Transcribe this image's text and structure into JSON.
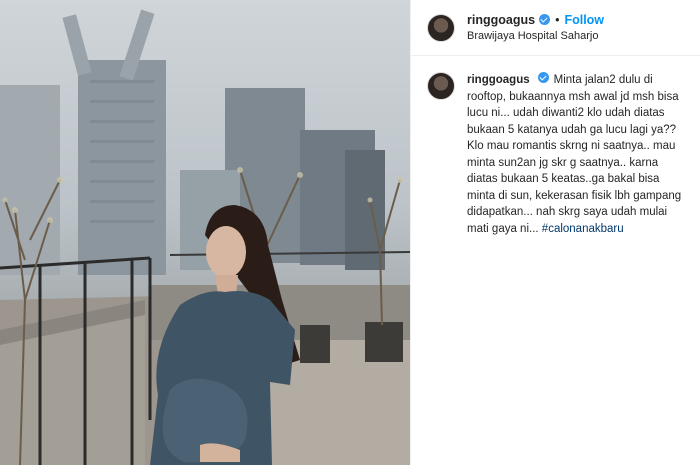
{
  "post": {
    "username": "ringgoagus",
    "follow_label": "Follow",
    "separator": "•",
    "location": "Brawijaya Hospital Saharjo"
  },
  "caption": {
    "username": "ringgoagus",
    "text": "Minta jalan2 dulu di rooftop, bukaannya msh awal jd msh bisa lucu ni... udah diwanti2 klo udah diatas bukaan 5 katanya udah ga lucu lagi ya?? Klo mau romantis skrng ni saatnya.. mau minta sun2an jg skr g saatnya.. karna diatas bukaan 5 keatas..ga bakal bisa minta di sun, kekerasan fisik lbh gampang didapatkan... nah skrg saya udah mulai mati gaya ni...",
    "hashtag": "#calonanakbaru"
  },
  "colors": {
    "link_blue": "#0095f6",
    "verified_blue": "#3897f0",
    "hashtag": "#00376b"
  },
  "icons": [
    "verified-badge-icon",
    "avatar"
  ]
}
